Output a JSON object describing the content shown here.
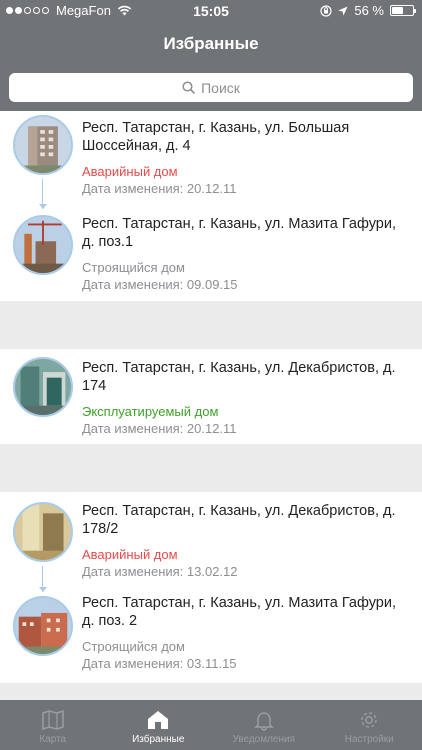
{
  "status_bar": {
    "carrier": "MegaFon",
    "time": "15:05",
    "battery_text": "56 %",
    "battery_level": 0.56
  },
  "header": {
    "title": "Избранные"
  },
  "search": {
    "placeholder": "Поиск",
    "icon": "search-icon"
  },
  "groups": [
    {
      "items": [
        {
          "address": "Респ. Татарстан, г. Казань, ул. Большая Шоссейная, д. 4",
          "status": "Аварийный дом",
          "status_color": "#e84a4a",
          "date": "Дата изменения: 20.12.11"
        },
        {
          "address": "Респ. Татарстан, г. Казань, ул. Мазита Гафури, д. поз.1",
          "status": "Строящийся дом",
          "status_color": "#8e8e93",
          "date": "Дата изменения: 09.09.15"
        }
      ]
    },
    {
      "items": [
        {
          "address": "Респ. Татарстан, г. Казань, ул. Декабристов, д. 174",
          "status": "Эксплуатируемый дом",
          "status_color": "#3fa12a",
          "date": "Дата изменения: 20.12.11"
        }
      ]
    },
    {
      "items": [
        {
          "address": "Респ. Татарстан, г. Казань, ул. Декабристов, д. 178/2",
          "status": "Аварийный дом",
          "status_color": "#e84a4a",
          "date": "Дата изменения: 13.02.12"
        },
        {
          "address": "Респ. Татарстан, г. Казань, ул. Мазита Гафури, д. поз. 2",
          "status": "Строящийся дом",
          "status_color": "#8e8e93",
          "date": "Дата изменения: 03.11.15"
        }
      ]
    }
  ],
  "tabbar": {
    "tabs": [
      {
        "label": "Карта",
        "icon": "map-icon",
        "active": false
      },
      {
        "label": "Избранные",
        "icon": "home-icon",
        "active": true
      },
      {
        "label": "Уведомления",
        "icon": "bell-icon",
        "active": false
      },
      {
        "label": "Настройки",
        "icon": "gear-icon",
        "active": false
      }
    ]
  },
  "colors": {
    "header_bg": "#707478",
    "tab_active": "#ffffff",
    "tab_inactive": "#9a9da1",
    "connector": "#a7cbe8"
  }
}
